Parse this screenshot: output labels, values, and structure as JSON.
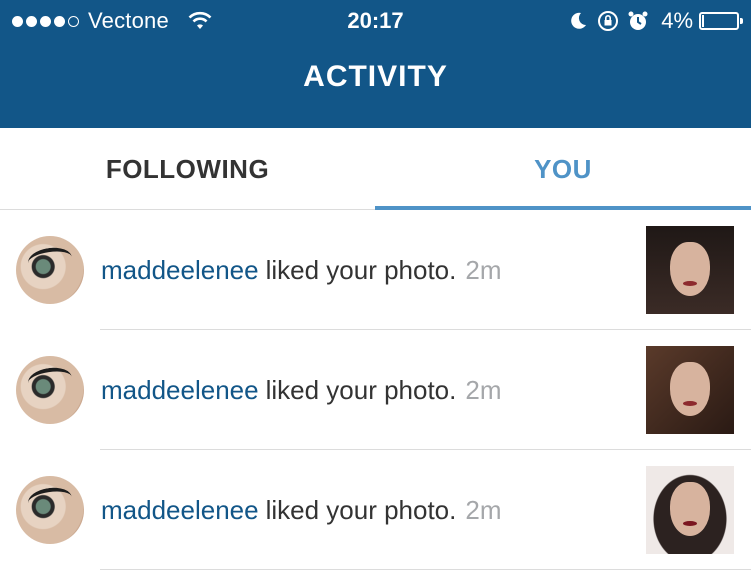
{
  "status_bar": {
    "carrier": "Vectone",
    "signal_bars_filled": 4,
    "signal_bars_total": 5,
    "time": "20:17",
    "battery_percent": "4%",
    "battery_level": 0.04,
    "icons": [
      "moon-icon",
      "rotation-lock-icon",
      "alarm-icon",
      "wifi-icon"
    ]
  },
  "header": {
    "title": "ACTIVITY",
    "background_color": "#125688"
  },
  "tabs": [
    {
      "label": "FOLLOWING",
      "active": false
    },
    {
      "label": "YOU",
      "active": true
    }
  ],
  "accent_color": "#4f93c7",
  "notifications": [
    {
      "username": "maddeelenee",
      "action": "liked your photo.",
      "time": "2m"
    },
    {
      "username": "maddeelenee",
      "action": "liked your photo.",
      "time": "2m"
    },
    {
      "username": "maddeelenee",
      "action": "liked your photo.",
      "time": "2m"
    }
  ]
}
